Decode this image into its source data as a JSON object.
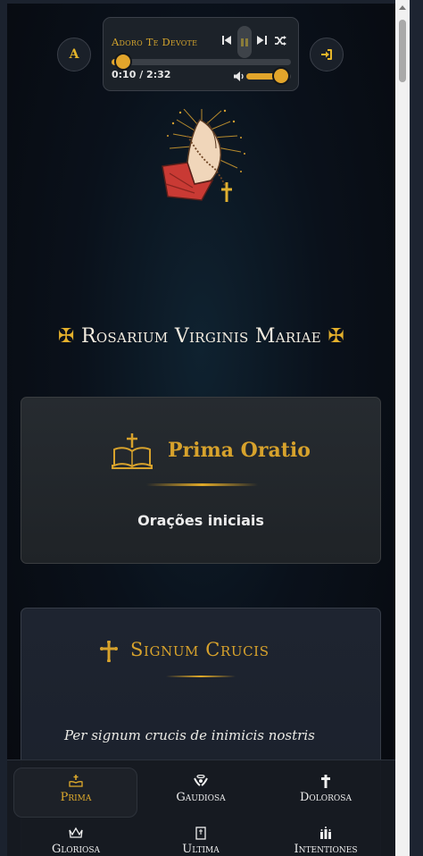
{
  "header": {
    "font_button_label": "A",
    "login_icon": "login-icon"
  },
  "player": {
    "track_title": "Adoro Te Devote",
    "time_display": "0:10 / 2:32",
    "progress_fraction": 0.066,
    "volume_fraction": 0.7,
    "controls": [
      "previous-icon",
      "pause-icon",
      "next-icon",
      "shuffle-icon",
      "volume-icon"
    ]
  },
  "main": {
    "title": "Rosarium Virginis Mariae",
    "title_ornament": "✠",
    "card_prima": {
      "title": "Prima Oratio",
      "subtitle": "Orações iniciais",
      "icon": "bible-cross-icon"
    },
    "card_signum": {
      "title": "Signum Crucis",
      "icon": "cross-icon",
      "text": "Per signum crucis de inimicis nostris"
    }
  },
  "nav": {
    "items": [
      {
        "label": "Prima",
        "icon": "bible-icon",
        "active": true
      },
      {
        "label": "Gaudiosa",
        "icon": "angel-icon"
      },
      {
        "label": "Dolorosa",
        "icon": "cross-icon"
      },
      {
        "label": "Gloriosa",
        "icon": "crown-icon"
      },
      {
        "label": "Ultima",
        "icon": "book-icon"
      },
      {
        "label": "Intentiones",
        "icon": "candles-icon"
      }
    ]
  },
  "colors": {
    "accent": "#e2a52b",
    "title_text": "#f3ece0",
    "background": "#0a111b"
  }
}
